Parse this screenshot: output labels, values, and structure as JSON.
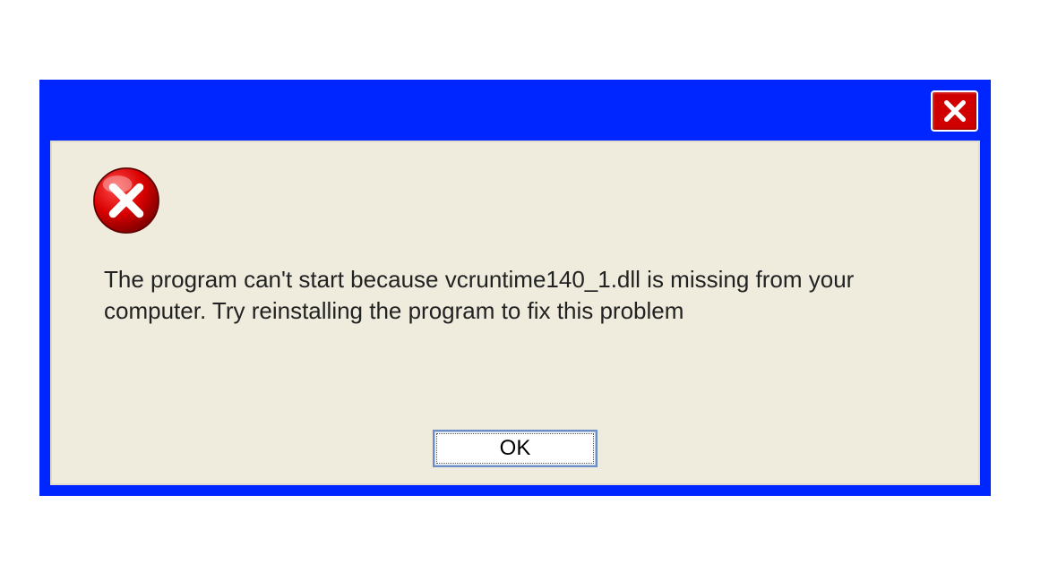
{
  "dialog": {
    "message": "The program can't start because vcruntime140_1.dll is missing from your computer. Try reinstalling the program to fix this problem",
    "ok_label": "OK"
  }
}
